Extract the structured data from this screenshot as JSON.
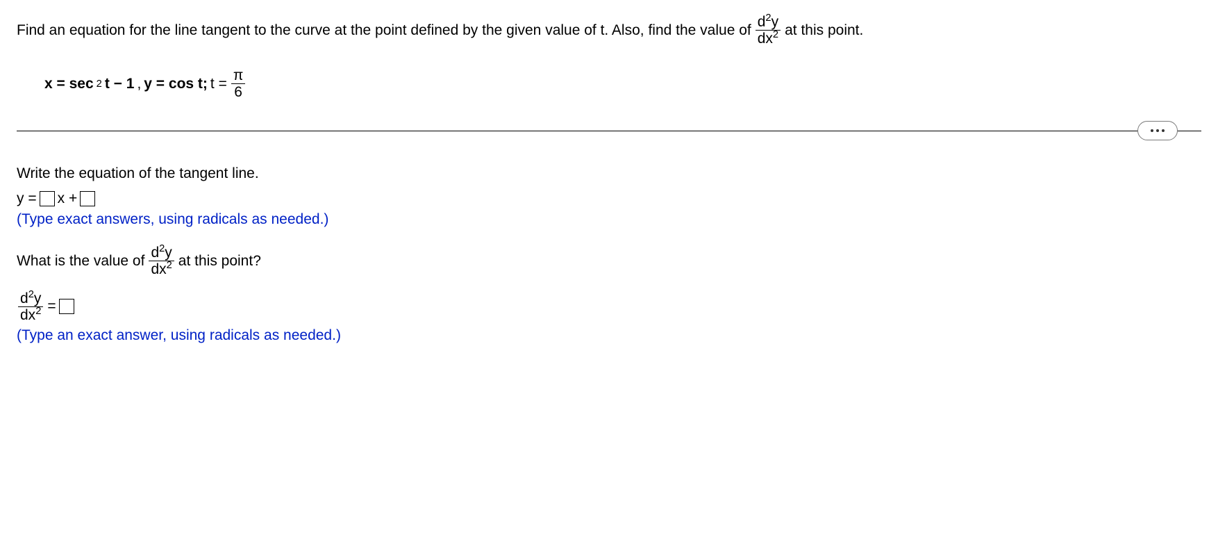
{
  "problem": {
    "text_before_frac": "Find an equation for the line tangent to the curve at the point defined by the given value of t. Also, find the value of ",
    "text_after_frac": " at this point.",
    "d2y_num": "d",
    "d2y_num_exp": "2",
    "d2y_num_var": "y",
    "d2y_den": "dx",
    "d2y_den_exp": "2"
  },
  "given": {
    "x_eq": "x = sec",
    "sec_exp": "2",
    "after_sec": " t − 1",
    "comma": " , ",
    "y_eq": "y = cos  t;",
    "t_eq": " t = ",
    "pi": "π",
    "six": "6"
  },
  "q1": {
    "prompt": "Write the equation of the tangent line.",
    "y_equals": "y = ",
    "x_plus": "x + ",
    "hint": "(Type exact answers, using radicals as needed.)"
  },
  "q2": {
    "prompt_before": "What is the value of ",
    "prompt_after": " at this point?",
    "equals": " = ",
    "hint": "(Type an exact answer, using radicals as needed.)"
  }
}
